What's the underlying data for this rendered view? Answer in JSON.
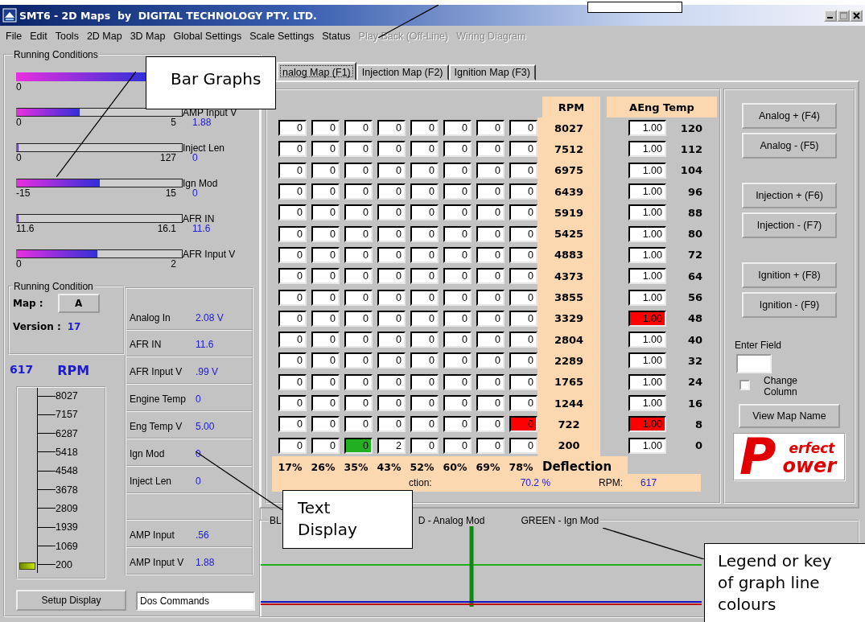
{
  "window": {
    "title": "SMT6 - 2D Maps  by  DIGITAL TECHNOLOGY PTY. LTD."
  },
  "menu": [
    {
      "label": "File",
      "disabled": false
    },
    {
      "label": "Edit",
      "disabled": false
    },
    {
      "label": "Tools",
      "disabled": false
    },
    {
      "label": "2D Map",
      "disabled": false
    },
    {
      "label": "3D Map",
      "disabled": false
    },
    {
      "label": "Global Settings",
      "disabled": false
    },
    {
      "label": "Scale Settings",
      "disabled": false
    },
    {
      "label": "Status",
      "disabled": false
    },
    {
      "label": "Play Back (Off-Line)",
      "disabled": true
    },
    {
      "label": "Wiring Diagram",
      "disabled": true
    }
  ],
  "running_conditions": {
    "title": "Running Conditions",
    "bars": [
      {
        "min": "0",
        "level": 1.0
      },
      {
        "label": "AMP Input V",
        "min": "0",
        "max": "5",
        "reading": "1.88",
        "level": 0.38
      },
      {
        "label": "Inject Len",
        "min": "0",
        "max": "127",
        "reading": "0",
        "level": 0.01
      },
      {
        "label": "Ign Mod",
        "min": "-15",
        "max": "15",
        "reading": "0",
        "level": 0.5
      },
      {
        "label": "AFR IN",
        "min": "11.6",
        "max": "16.1",
        "reading": "11.6",
        "level": 0.01
      },
      {
        "label": "AFR Input V",
        "min": "0",
        "max": "2",
        "level": 0.49
      }
    ]
  },
  "running_condition": {
    "title": "Running Condition",
    "map_label": "Map :",
    "map_button": "A",
    "version_label": "Version :",
    "version": "17"
  },
  "rpm_gauge": {
    "value": "617",
    "unit": "RPM",
    "ticks": [
      "8027",
      "7157",
      "6287",
      "5418",
      "4548",
      "3678",
      "2809",
      "1939",
      "1069",
      "200"
    ],
    "level": 0.04
  },
  "readouts": [
    {
      "kind": "reading",
      "label": "Analog In",
      "value": "2.08 V"
    },
    {
      "kind": "reading",
      "label": "AFR IN",
      "value": "11.6"
    },
    {
      "kind": "reading",
      "label": "AFR Input V",
      "value": ".99 V"
    },
    {
      "kind": "reading",
      "label": "Engine Temp",
      "value": "0"
    },
    {
      "kind": "reading",
      "label": "Eng Temp V",
      "value": "5.00"
    },
    {
      "kind": "reading",
      "label": "Ign Mod",
      "value": "0"
    },
    {
      "kind": "reading",
      "label": "Inject Len",
      "value": "0"
    },
    {
      "kind": "blank"
    },
    {
      "kind": "reading",
      "label": "AMP Input",
      "value": ".56"
    },
    {
      "kind": "reading",
      "label": "AMP Input V",
      "value": "1.88"
    }
  ],
  "setup_button": "Setup Display",
  "dos_field": {
    "value": "Dos Commands"
  },
  "tabs": [
    {
      "label": "nalog Map (F1)",
      "selected": true
    },
    {
      "label": "Injection Map (F2)",
      "selected": false
    },
    {
      "label": "Ignition Map (F3)",
      "selected": false
    }
  ],
  "map": {
    "rpm_header": "RPM",
    "temp_header": "AEng Temp",
    "rows": [
      {
        "cells": [
          {
            "value": "0",
            "color": "#ffffff"
          },
          {
            "value": "0",
            "color": "#ffffff"
          },
          {
            "value": "0",
            "color": "#ffffff"
          },
          {
            "value": "0",
            "color": "#ffffff"
          },
          {
            "value": "0",
            "color": "#ffffff"
          },
          {
            "value": "0",
            "color": "#ffffff"
          },
          {
            "value": "0",
            "color": "#ffffff"
          },
          {
            "value": "0",
            "color": "#ffffff"
          }
        ],
        "rpm": "8027",
        "factor": {
          "value": "1.00",
          "color": "#ffffff"
        },
        "temp": "120"
      },
      {
        "cells": [
          {
            "value": "0",
            "color": "#ffffff"
          },
          {
            "value": "0",
            "color": "#ffffff"
          },
          {
            "value": "0",
            "color": "#ffffff"
          },
          {
            "value": "0",
            "color": "#ffffff"
          },
          {
            "value": "0",
            "color": "#ffffff"
          },
          {
            "value": "0",
            "color": "#ffffff"
          },
          {
            "value": "0",
            "color": "#ffffff"
          },
          {
            "value": "0",
            "color": "#ffffff"
          }
        ],
        "rpm": "7512",
        "factor": {
          "value": "1.00",
          "color": "#ffffff"
        },
        "temp": "112"
      },
      {
        "cells": [
          {
            "value": "0",
            "color": "#ffffff"
          },
          {
            "value": "0",
            "color": "#ffffff"
          },
          {
            "value": "0",
            "color": "#ffffff"
          },
          {
            "value": "0",
            "color": "#ffffff"
          },
          {
            "value": "0",
            "color": "#ffffff"
          },
          {
            "value": "0",
            "color": "#ffffff"
          },
          {
            "value": "0",
            "color": "#ffffff"
          },
          {
            "value": "0",
            "color": "#ffffff"
          }
        ],
        "rpm": "6975",
        "factor": {
          "value": "1.00",
          "color": "#ffffff"
        },
        "temp": "104"
      },
      {
        "cells": [
          {
            "value": "0",
            "color": "#ffffff"
          },
          {
            "value": "0",
            "color": "#ffffff"
          },
          {
            "value": "0",
            "color": "#ffffff"
          },
          {
            "value": "0",
            "color": "#ffffff"
          },
          {
            "value": "0",
            "color": "#ffffff"
          },
          {
            "value": "0",
            "color": "#ffffff"
          },
          {
            "value": "0",
            "color": "#ffffff"
          },
          {
            "value": "0",
            "color": "#ffffff"
          }
        ],
        "rpm": "6439",
        "factor": {
          "value": "1.00",
          "color": "#ffffff"
        },
        "temp": "96"
      },
      {
        "cells": [
          {
            "value": "0",
            "color": "#ffffff"
          },
          {
            "value": "0",
            "color": "#ffffff"
          },
          {
            "value": "0",
            "color": "#ffffff"
          },
          {
            "value": "0",
            "color": "#ffffff"
          },
          {
            "value": "0",
            "color": "#ffffff"
          },
          {
            "value": "0",
            "color": "#ffffff"
          },
          {
            "value": "0",
            "color": "#ffffff"
          },
          {
            "value": "0",
            "color": "#ffffff"
          }
        ],
        "rpm": "5919",
        "factor": {
          "value": "1.00",
          "color": "#ffffff"
        },
        "temp": "88"
      },
      {
        "cells": [
          {
            "value": "0",
            "color": "#ffffff"
          },
          {
            "value": "0",
            "color": "#ffffff"
          },
          {
            "value": "0",
            "color": "#ffffff"
          },
          {
            "value": "0",
            "color": "#ffffff"
          },
          {
            "value": "0",
            "color": "#ffffff"
          },
          {
            "value": "0",
            "color": "#ffffff"
          },
          {
            "value": "0",
            "color": "#ffffff"
          },
          {
            "value": "0",
            "color": "#ffffff"
          }
        ],
        "rpm": "5425",
        "factor": {
          "value": "1.00",
          "color": "#ffffff"
        },
        "temp": "80"
      },
      {
        "cells": [
          {
            "value": "0",
            "color": "#ffffff"
          },
          {
            "value": "0",
            "color": "#ffffff"
          },
          {
            "value": "0",
            "color": "#ffffff"
          },
          {
            "value": "0",
            "color": "#ffffff"
          },
          {
            "value": "0",
            "color": "#ffffff"
          },
          {
            "value": "0",
            "color": "#ffffff"
          },
          {
            "value": "0",
            "color": "#ffffff"
          },
          {
            "value": "0",
            "color": "#ffffff"
          }
        ],
        "rpm": "4883",
        "factor": {
          "value": "1.00",
          "color": "#ffffff"
        },
        "temp": "72"
      },
      {
        "cells": [
          {
            "value": "0",
            "color": "#ffffff"
          },
          {
            "value": "0",
            "color": "#ffffff"
          },
          {
            "value": "0",
            "color": "#ffffff"
          },
          {
            "value": "0",
            "color": "#ffffff"
          },
          {
            "value": "0",
            "color": "#ffffff"
          },
          {
            "value": "0",
            "color": "#ffffff"
          },
          {
            "value": "0",
            "color": "#ffffff"
          },
          {
            "value": "0",
            "color": "#ffffff"
          }
        ],
        "rpm": "4373",
        "factor": {
          "value": "1.00",
          "color": "#ffffff"
        },
        "temp": "64"
      },
      {
        "cells": [
          {
            "value": "0",
            "color": "#ffffff"
          },
          {
            "value": "0",
            "color": "#ffffff"
          },
          {
            "value": "0",
            "color": "#ffffff"
          },
          {
            "value": "0",
            "color": "#ffffff"
          },
          {
            "value": "0",
            "color": "#ffffff"
          },
          {
            "value": "0",
            "color": "#ffffff"
          },
          {
            "value": "0",
            "color": "#ffffff"
          },
          {
            "value": "0",
            "color": "#ffffff"
          }
        ],
        "rpm": "3855",
        "factor": {
          "value": "1.00",
          "color": "#ffffff"
        },
        "temp": "56"
      },
      {
        "cells": [
          {
            "value": "0",
            "color": "#ffffff"
          },
          {
            "value": "0",
            "color": "#ffffff"
          },
          {
            "value": "0",
            "color": "#ffffff"
          },
          {
            "value": "0",
            "color": "#ffffff"
          },
          {
            "value": "0",
            "color": "#ffffff"
          },
          {
            "value": "0",
            "color": "#ffffff"
          },
          {
            "value": "0",
            "color": "#ffffff"
          },
          {
            "value": "0",
            "color": "#ffffff"
          }
        ],
        "rpm": "3329",
        "factor": {
          "value": "1.00",
          "color": "#ff0000"
        },
        "temp": "48"
      },
      {
        "cells": [
          {
            "value": "0",
            "color": "#ffffff"
          },
          {
            "value": "0",
            "color": "#ffffff"
          },
          {
            "value": "0",
            "color": "#ffffff"
          },
          {
            "value": "0",
            "color": "#ffffff"
          },
          {
            "value": "0",
            "color": "#ffffff"
          },
          {
            "value": "0",
            "color": "#ffffff"
          },
          {
            "value": "0",
            "color": "#ffffff"
          },
          {
            "value": "0",
            "color": "#ffffff"
          }
        ],
        "rpm": "2804",
        "factor": {
          "value": "1.00",
          "color": "#ffffff"
        },
        "temp": "40"
      },
      {
        "cells": [
          {
            "value": "0",
            "color": "#ffffff"
          },
          {
            "value": "0",
            "color": "#ffffff"
          },
          {
            "value": "0",
            "color": "#ffffff"
          },
          {
            "value": "0",
            "color": "#ffffff"
          },
          {
            "value": "0",
            "color": "#ffffff"
          },
          {
            "value": "0",
            "color": "#ffffff"
          },
          {
            "value": "0",
            "color": "#ffffff"
          },
          {
            "value": "0",
            "color": "#ffffff"
          }
        ],
        "rpm": "2289",
        "factor": {
          "value": "1.00",
          "color": "#ffffff"
        },
        "temp": "32"
      },
      {
        "cells": [
          {
            "value": "0",
            "color": "#ffffff"
          },
          {
            "value": "0",
            "color": "#ffffff"
          },
          {
            "value": "0",
            "color": "#ffffff"
          },
          {
            "value": "0",
            "color": "#ffffff"
          },
          {
            "value": "0",
            "color": "#ffffff"
          },
          {
            "value": "0",
            "color": "#ffffff"
          },
          {
            "value": "0",
            "color": "#ffffff"
          },
          {
            "value": "0",
            "color": "#ffffff"
          }
        ],
        "rpm": "1765",
        "factor": {
          "value": "1.00",
          "color": "#ffffff"
        },
        "temp": "24"
      },
      {
        "cells": [
          {
            "value": "0",
            "color": "#ffffff"
          },
          {
            "value": "0",
            "color": "#ffffff"
          },
          {
            "value": "0",
            "color": "#ffffff"
          },
          {
            "value": "0",
            "color": "#ffffff"
          },
          {
            "value": "0",
            "color": "#ffffff"
          },
          {
            "value": "0",
            "color": "#ffffff"
          },
          {
            "value": "0",
            "color": "#ffffff"
          },
          {
            "value": "0",
            "color": "#ffffff"
          }
        ],
        "rpm": "1244",
        "factor": {
          "value": "1.00",
          "color": "#ffffff"
        },
        "temp": "16"
      },
      {
        "cells": [
          {
            "value": "0",
            "color": "#ffffff"
          },
          {
            "value": "0",
            "color": "#ffffff"
          },
          {
            "value": "0",
            "color": "#ffffff"
          },
          {
            "value": "0",
            "color": "#ffffff"
          },
          {
            "value": "0",
            "color": "#ffffff"
          },
          {
            "value": "0",
            "color": "#ffffff"
          },
          {
            "value": "0",
            "color": "#ffffff"
          },
          {
            "value": "0",
            "color": "#ff0000"
          }
        ],
        "rpm": "722",
        "factor": {
          "value": "1.00",
          "color": "#ff0000"
        },
        "temp": "8"
      },
      {
        "cells": [
          {
            "value": "0",
            "color": "#ffffff"
          },
          {
            "value": "0",
            "color": "#ffffff"
          },
          {
            "value": "0",
            "color": "#22b022"
          },
          {
            "value": "2",
            "color": "#ffffff"
          },
          {
            "value": "0",
            "color": "#ffffff"
          },
          {
            "value": "0",
            "color": "#ffffff"
          },
          {
            "value": "0",
            "color": "#ffffff"
          },
          {
            "value": "0",
            "color": "#ffffff"
          }
        ],
        "rpm": "200",
        "factor": {
          "value": "1.00",
          "color": "#ffffff"
        },
        "temp": "0"
      }
    ],
    "percent_row": [
      "17%",
      "26%",
      "35%",
      "43%",
      "52%",
      "60%",
      "69%",
      "78%"
    ],
    "deflection": "Deflection",
    "footer": {
      "deflection_label": "ction:",
      "deflection_value": "70.2 %",
      "rpm_label": "RPM:",
      "rpm_value": "617"
    }
  },
  "buttons": [
    "Analog + (F4)",
    "Analog - (F5)",
    "Injection + (F6)",
    "Injection - (F7)",
    "Ignition + (F8)",
    "Ignition - (F9)"
  ],
  "enter_field": {
    "label": "Enter Field"
  },
  "change_column": {
    "label": "Change Column",
    "checked": false
  },
  "view_map_name": "View Map Name",
  "logo": {
    "initial": "P",
    "top": "erfect",
    "bottom": "ower"
  },
  "trace_graph": {
    "legend": [
      "BL",
      "D - Analog Mod",
      "GREEN - Ign Mod"
    ]
  },
  "callouts": [
    {
      "kind": "blank"
    },
    {
      "kind": "note",
      "text": "Bar Graphs"
    },
    {
      "kind": "note",
      "text": "Text Display"
    },
    {
      "kind": "note",
      "text": "Legend or key of graph line colours"
    }
  ]
}
